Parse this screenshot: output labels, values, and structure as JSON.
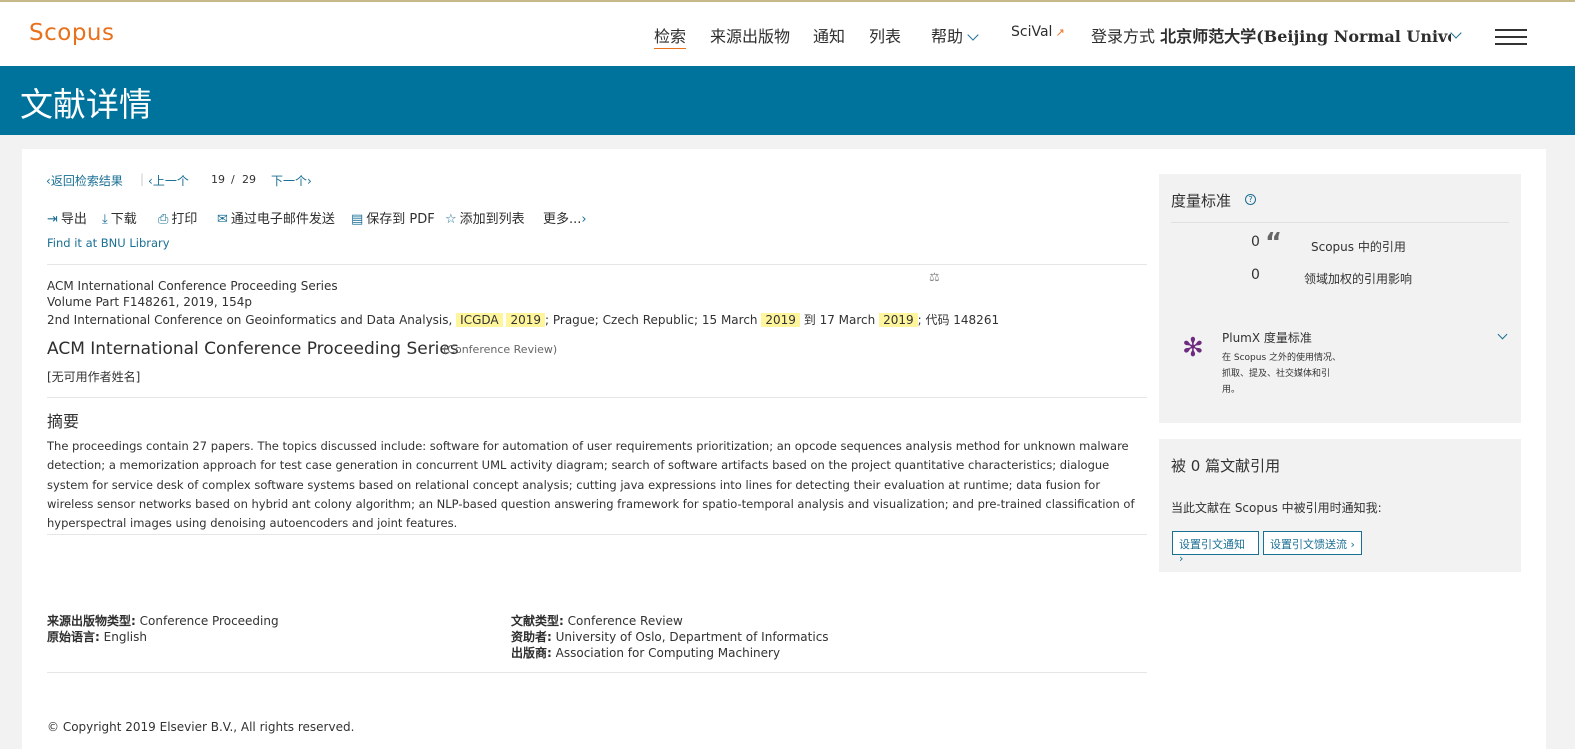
{
  "app": {
    "logo": "Scopus"
  },
  "nav": {
    "search": "检索",
    "sources": "来源出版物",
    "alerts": "通知",
    "lists": "列表",
    "help": "帮助",
    "scival": "SciVal",
    "login_prefix": "登录方式",
    "institution": "北京师范大学(Beijing Normal Universi"
  },
  "page": {
    "title": "文献详情"
  },
  "pager": {
    "back": "返回检索结果",
    "prev": "上一个",
    "current": "19",
    "slash": "/",
    "total": "29",
    "next": "下一个"
  },
  "toolbar": {
    "export": "导出",
    "download": "下载",
    "print": "打印",
    "email": "通过电子邮件发送",
    "save_pdf": "保存到 PDF",
    "add_list": "添加到列表",
    "more": "更多..."
  },
  "library_link": "Find it at BNU Library",
  "source": {
    "series": "ACM International Conference Proceeding Series",
    "volume": "Volume Part F148261, 2019, 154p",
    "conf_prefix": "2nd International Conference on Geoinformatics and Data Analysis,",
    "conf_acr": "ICGDA",
    "conf_year": "2019",
    "conf_loc": "; Prague; Czech Republic; 15 March",
    "date1_year": "2019",
    "to": "到 17 March",
    "date2_year": "2019",
    "code": "; 代码 148261"
  },
  "doc": {
    "title": "ACM International Conference Proceeding Series",
    "type_note": "(Conference Review)",
    "authors": "[无可用作者姓名]"
  },
  "abstract": {
    "heading": "摘要",
    "text": "The proceedings contain 27 papers. The topics discussed include: software for automation of user requirements prioritization; an opcode sequences analysis method for unknown malware detection; a memorization approach for test case generation in concurrent UML activity diagram; search of software artifacts based on the project quantitative characteristics; dialogue system for service desk of complex software systems based on relational concept analysis; cutting java expressions into lines for detecting their evaluation at runtime; data fusion for wireless sensor networks based on hybrid ant colony algorithm; an NLP-based question answering framework for spatio-temporal analysis and visualization; and pre-trained classification of hyperspectral images using denoising autoencoders and joint features."
  },
  "info": {
    "source_type_label": "来源出版物类型:",
    "source_type": "Conference Proceeding",
    "language_label": "原始语言:",
    "language": "English",
    "doc_type_label": "文献类型:",
    "doc_type": "Conference Review",
    "sponsor_label": "资助者:",
    "sponsor": "University of Oslo, Department of Informatics",
    "publisher_label": "出版商:",
    "publisher": "Association for Computing Machinery"
  },
  "copyright": "© Copyright 2019 Elsevier B.V., All rights reserved.",
  "metrics": {
    "heading": "度量标准",
    "citations_count": "0",
    "citations_label": "Scopus 中的引用",
    "fwci_count": "0",
    "fwci_label": "领域加权的引用影响",
    "plumx_title": "PlumX 度量标准",
    "plumx_desc1": "在 Scopus 之外的使用情况、",
    "plumx_desc2": "抓取、提及、社交媒体和引",
    "plumx_desc3": "用。"
  },
  "cited_by": {
    "heading": "被 0 篇文献引用",
    "notify_text": "当此文献在 Scopus 中被引用时通知我:",
    "set_alert": "设置引文通知",
    "set_feed": "设置引文馈送流"
  },
  "colors": {
    "brand_orange": "#e9711c",
    "banner_blue": "#00739d",
    "link_blue": "#1a6f94",
    "highlight": "#fff59d"
  },
  "icons": [
    "hamburger-icon",
    "chevron-down-icon",
    "external-link-icon",
    "help-icon",
    "quote-icon",
    "plumx-icon",
    "export-icon",
    "download-icon",
    "print-icon",
    "email-icon",
    "pdf-icon",
    "star-icon"
  ]
}
